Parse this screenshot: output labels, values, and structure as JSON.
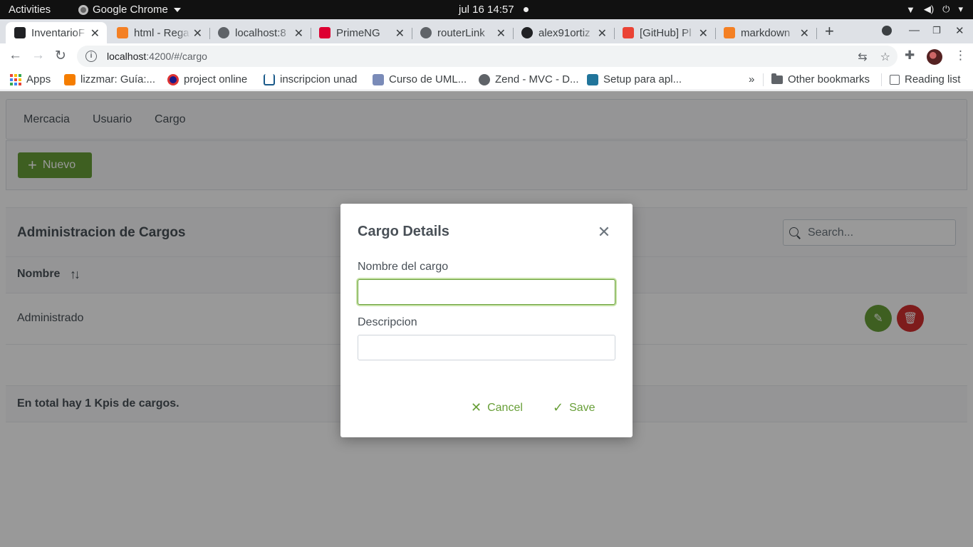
{
  "gnome": {
    "activities": "Activities",
    "app_name": "Google Chrome",
    "clock": "jul 16  14:57"
  },
  "tabs": [
    {
      "title": "InventarioF",
      "active": true,
      "fav_color": "#202124"
    },
    {
      "title": "html - Rega",
      "active": false,
      "fav_color": "#f48024"
    },
    {
      "title": "localhost:8",
      "active": false,
      "fav_color": "#5f6368"
    },
    {
      "title": "PrimeNG",
      "active": false,
      "fav_color": "#dd0031"
    },
    {
      "title": "routerLink",
      "active": false,
      "fav_color": "#5f6368"
    },
    {
      "title": "alex91ortiz",
      "active": false,
      "fav_color": "#202124"
    },
    {
      "title": "[GitHub] Pl",
      "active": false,
      "fav_color": "#ea4335"
    },
    {
      "title": "markdown",
      "active": false,
      "fav_color": "#f48024"
    }
  ],
  "omnibox": {
    "host": "localhost",
    "path": ":4200/#/cargo"
  },
  "bookmarks": {
    "items": [
      {
        "label": "Apps"
      },
      {
        "label": "lizzmar: Guía:..."
      },
      {
        "label": "project online"
      },
      {
        "label": "inscripcion unad"
      },
      {
        "label": "Curso de UML..."
      },
      {
        "label": "Zend - MVC - D..."
      },
      {
        "label": "Setup para apl..."
      }
    ],
    "overflow": "»",
    "other": "Other bookmarks",
    "reading_list": "Reading list"
  },
  "app": {
    "menu": [
      "Mercacia",
      "Usuario",
      "Cargo"
    ],
    "new_button": "Nuevo",
    "table_title": "Administracion de Cargos",
    "search_placeholder": "Search...",
    "column_header": "Nombre",
    "rows": [
      {
        "nombre": "Administrado"
      }
    ],
    "footer": "En total hay 1 Kpis de cargos."
  },
  "dialog": {
    "title": "Cargo Details",
    "field1_label": "Nombre del cargo",
    "field1_value": "",
    "field2_label": "Descripcion",
    "field2_value": "",
    "cancel": "Cancel",
    "save": "Save"
  },
  "colors": {
    "primary_green": "#689f38",
    "danger_red": "#d32f2f"
  }
}
